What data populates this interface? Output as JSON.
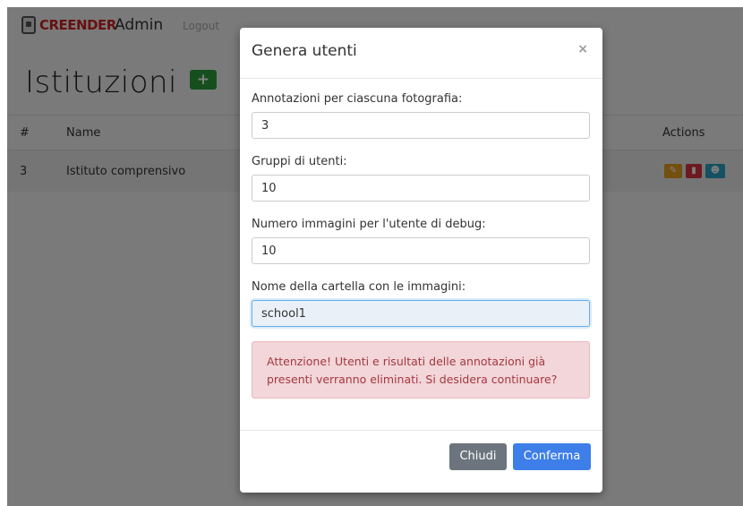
{
  "nav": {
    "brand": "CREENDER",
    "admin": "Admin",
    "logout": "Logout"
  },
  "page": {
    "title": "Istituzioni",
    "add_label": "+"
  },
  "table": {
    "headers": {
      "num": "#",
      "name": "Name",
      "actions": "Actions"
    },
    "rows": [
      {
        "num": "3",
        "name": "Istituto comprensivo"
      }
    ],
    "action_icons": [
      "edit-icon",
      "trash-icon",
      "user-add-icon"
    ],
    "action_colors": [
      "#e6a020",
      "#d9343f",
      "#2aa3c3"
    ]
  },
  "modal": {
    "title": "Genera utenti",
    "close": "×",
    "fields": [
      {
        "label": "Annotazioni per ciascuna fotografia:",
        "value": "3"
      },
      {
        "label": "Gruppi di utenti:",
        "value": "10"
      },
      {
        "label": "Numero immagini per l'utente di debug:",
        "value": "10"
      },
      {
        "label": "Nome della cartella con le immagini:",
        "value": "school1"
      }
    ],
    "warning": "Attenzione! Utenti e risultati delle annotazioni già presenti verranno eliminati. Si desidera continuare?",
    "buttons": {
      "close": "Chiudi",
      "confirm": "Conferma"
    }
  }
}
